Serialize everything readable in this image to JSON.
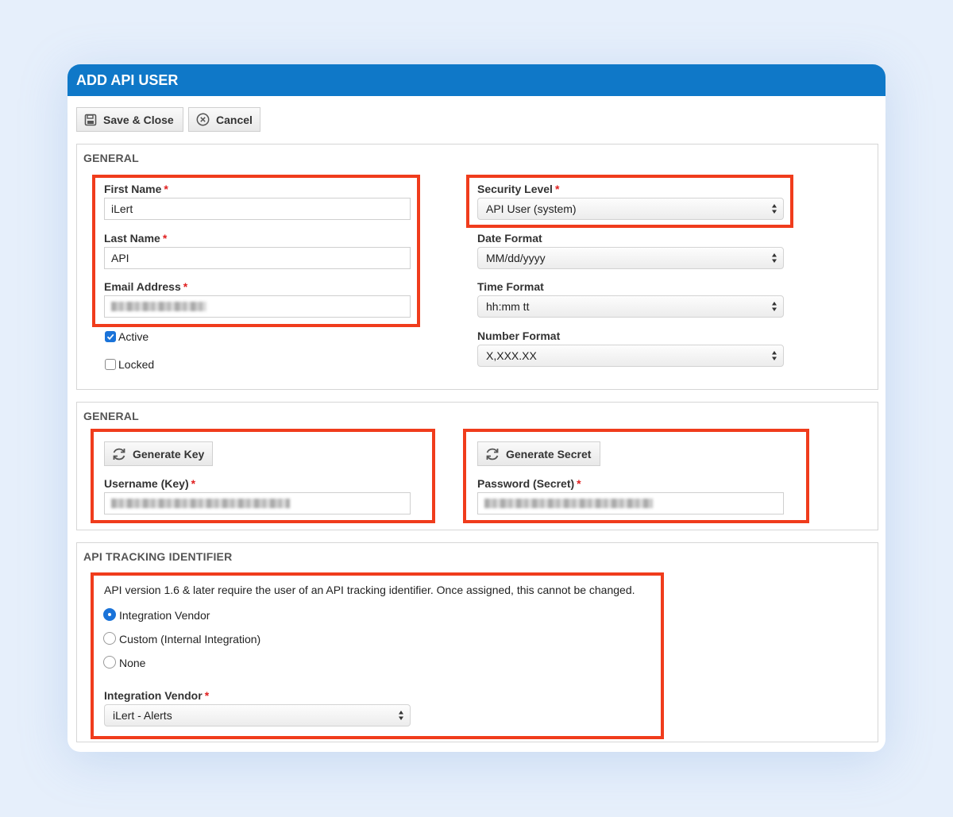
{
  "dialog": {
    "title": "ADD API USER",
    "accent_color": "#0f78c8",
    "highlight_color": "#f03c1c"
  },
  "toolbar": {
    "save_label": "Save & Close",
    "save_icon": "floppy-disk-icon",
    "cancel_label": "Cancel",
    "cancel_icon": "close-circle-icon"
  },
  "general": {
    "title": "GENERAL",
    "first_name": {
      "label": "First Name",
      "value": "iLert"
    },
    "last_name": {
      "label": "Last Name",
      "value": "API"
    },
    "email": {
      "label": "Email Address",
      "value": ""
    },
    "active": {
      "label": "Active",
      "checked": true
    },
    "locked": {
      "label": "Locked",
      "checked": false
    },
    "security_level": {
      "label": "Security Level",
      "value": "API User (system)"
    },
    "date_format": {
      "label": "Date Format",
      "value": "MM/dd/yyyy"
    },
    "time_format": {
      "label": "Time Format",
      "value": "hh:mm tt"
    },
    "number_format": {
      "label": "Number Format",
      "value": "X,XXX.XX"
    }
  },
  "credentials": {
    "title": "GENERAL",
    "generate_key_label": "Generate Key",
    "generate_secret_label": "Generate Secret",
    "refresh_icon": "refresh-icon",
    "username": {
      "label": "Username (Key)",
      "value": ""
    },
    "password": {
      "label": "Password (Secret)",
      "value": ""
    }
  },
  "tracking": {
    "title": "API TRACKING IDENTIFIER",
    "note": "API version 1.6 & later require the user of an API tracking identifier. Once assigned, this cannot be changed.",
    "options": [
      {
        "label": "Integration Vendor",
        "selected": true
      },
      {
        "label": "Custom (Internal Integration)",
        "selected": false
      },
      {
        "label": "None",
        "selected": false
      }
    ],
    "vendor": {
      "label": "Integration Vendor",
      "value": "iLert - Alerts"
    }
  },
  "required_mark": "*"
}
